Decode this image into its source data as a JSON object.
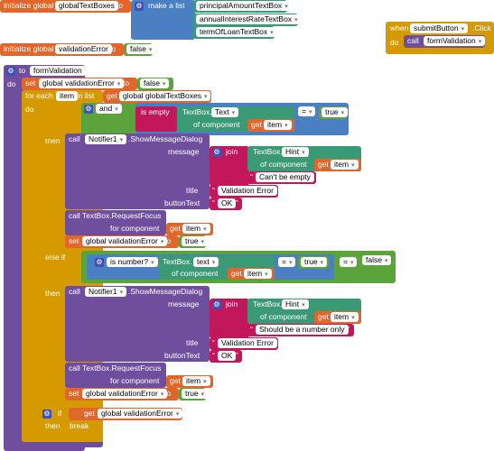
{
  "init1": {
    "keyword": "initialize global",
    "name": "globalTextBoxes",
    "to": "to",
    "make_list": "make a list",
    "items": [
      "principalAmountTextBox",
      "annualInterestRateTextBox",
      "termOfLoanTextBox"
    ]
  },
  "init2": {
    "keyword": "initialize global",
    "name": "validationError",
    "to": "to",
    "value": "false"
  },
  "event": {
    "when": "when",
    "component": "submitButton",
    "event": ".Click",
    "do": "do",
    "call": "call",
    "proc": "formValidation"
  },
  "proc": {
    "to": "to",
    "name": "formValidation",
    "do": "do",
    "set": "set",
    "set_var": "global validationError",
    "set_to": "to",
    "set_val": "false",
    "foreach": "for each",
    "item": "item",
    "in_list": "in list",
    "get": "get",
    "list_var": "global globalTextBoxes",
    "do2": "do",
    "if": "if",
    "and": "and",
    "is_empty": "is empty",
    "tb": "TextBox.",
    "text_prop": "Text",
    "of_component": "of component",
    "get_item": "item",
    "eq": "=",
    "true": "true",
    "then": "then",
    "call": "call",
    "notifier": "Notifier1",
    "show": ".ShowMessageDialog",
    "message": "message",
    "join": "join",
    "hint": "Hint",
    "msg1": "Can't be empty",
    "title": "title",
    "title_val": "Validation Error",
    "buttonText": "buttonText",
    "ok": "OK",
    "focus": "call TextBox.RequestFocus",
    "for_component": "for component",
    "set2": "set",
    "to2": "to",
    "else_if": "else if",
    "is_number": "is number?",
    "text_prop2": "text",
    "false": "false",
    "msg2": "Should be a number only",
    "if2": "if",
    "get2": "get",
    "break": "break"
  }
}
